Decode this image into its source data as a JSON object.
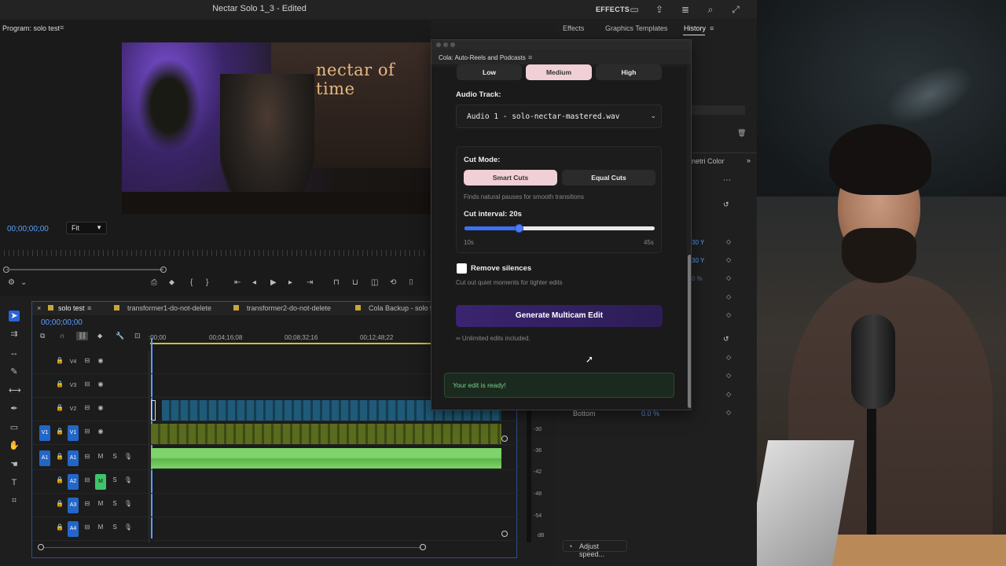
{
  "app": {
    "window_title": "Nectar Solo 1_3 - Edited",
    "effects_label": "EFFECTS"
  },
  "program_monitor": {
    "title": "Program: solo test",
    "video_sign": "nectar of time",
    "timecode": "00;00;00;00",
    "zoom_select": "Fit"
  },
  "timeline": {
    "tabs": [
      "solo test",
      "transformer1-do-not-delete",
      "transformer2-do-not-delete",
      "Cola Backup - solo tes"
    ],
    "timecode": "00;00;00;00",
    "ruler_labels": [
      ":00;00",
      "00;04;16;08",
      "00;08;32;16",
      "00;12;48;22"
    ],
    "tracks": [
      {
        "id": "V4"
      },
      {
        "id": "V3"
      },
      {
        "id": "V2"
      },
      {
        "id": "V1",
        "src": "V1"
      },
      {
        "id": "A1",
        "src": "A1",
        "m": "M",
        "s": "S"
      },
      {
        "id": "A2",
        "m": "M",
        "s": "S",
        "muted": true
      },
      {
        "id": "A3",
        "m": "M",
        "s": "S"
      },
      {
        "id": "A4",
        "m": "M",
        "s": "S"
      }
    ]
  },
  "right_panel": {
    "tabs": [
      "Effects",
      "Graphics Templates",
      "History"
    ],
    "lumetri_label": "netri Color",
    "bottom_label": "Bottom",
    "bottom_value": "0.0 %",
    "values": [
      "30 Y",
      "30 Y",
      "0 %"
    ],
    "adjust_speed": "Adjust speed..."
  },
  "audio_meter_labels": [
    "-30",
    "-36",
    "-42",
    "-48",
    "-54",
    "dB"
  ],
  "plugin": {
    "title": "Cola: Auto-Reels and Podcasts",
    "sensitivity": {
      "options": [
        "Low",
        "Medium",
        "High"
      ],
      "selected": "Medium"
    },
    "audio_track_label": "Audio Track:",
    "audio_track_value": "Audio 1 - solo-nectar-mastered.wav",
    "cut_mode_label": "Cut Mode:",
    "cut_modes": {
      "options": [
        "Smart Cuts",
        "Equal Cuts"
      ],
      "selected": "Smart Cuts"
    },
    "cut_mode_hint": "Finds natural pauses for smooth transitions",
    "cut_interval_label": "Cut interval: 20s",
    "cut_interval": {
      "min": 10,
      "max": 45,
      "value": 20,
      "min_label": "10s",
      "max_label": "45s"
    },
    "remove_silences_label": "Remove silences",
    "remove_silences_checked": false,
    "remove_silences_hint": "Cut out quiet moments for tighter edits",
    "generate_button": "Generate Multicam Edit",
    "unlimited_text": "∞ Unlimited edits included.",
    "status_message": "Your edit is ready!"
  },
  "colors": {
    "accent_blue": "#5aa0ff",
    "track_tag": "#2366c8",
    "mute_green": "#3ec46a",
    "selected_pill": "#f0cfd6",
    "generate_purple": "#3a2470",
    "slider_blue": "#3f6ff2",
    "success_green": "#7ad18d"
  }
}
